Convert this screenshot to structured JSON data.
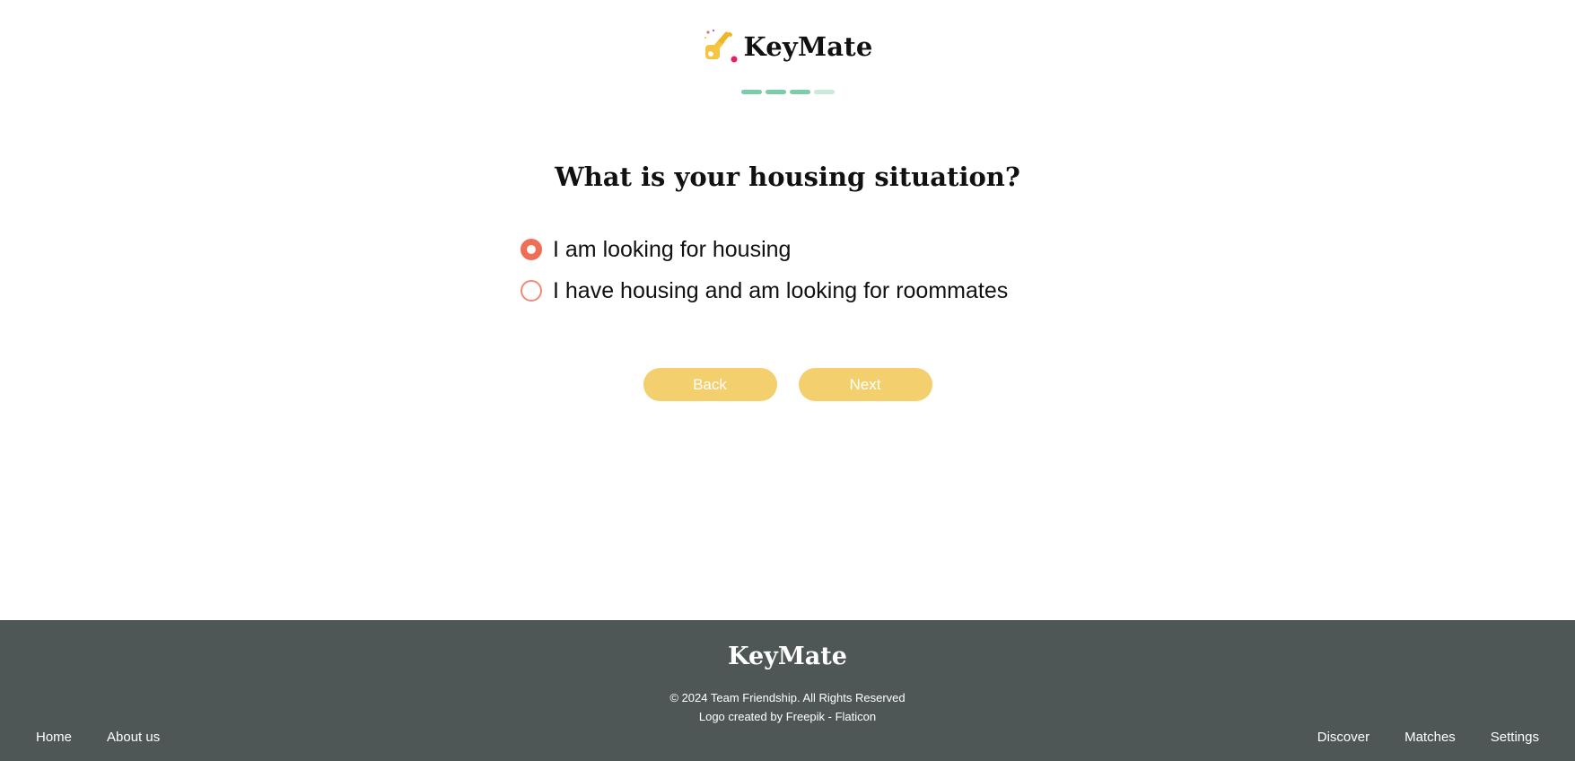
{
  "header": {
    "brand_name": "KeyMate",
    "logo_icon": "key-sparkle-icon"
  },
  "progress": {
    "total_steps": 4,
    "completed_steps": 3
  },
  "question": {
    "title": "What is your housing situation?",
    "options": [
      {
        "label": "I am looking for housing",
        "selected": true
      },
      {
        "label": "I have housing and am looking for roommates",
        "selected": false
      }
    ]
  },
  "actions": {
    "back_label": "Back",
    "next_label": "Next"
  },
  "footer": {
    "brand_name": "KeyMate",
    "copyright": "© 2024 Team Friendship. All Rights Reserved",
    "credit": "Logo created by Freepik - Flaticon",
    "nav_left": [
      "Home",
      "About us"
    ],
    "nav_right": [
      "Discover",
      "Matches",
      "Settings"
    ]
  },
  "colors": {
    "accent_radio": "#ef6e56",
    "button": "#f3d06d",
    "progress_done": "#7dcca9",
    "progress_todo": "#c8eadb",
    "footer_bg": "#4e5756"
  }
}
